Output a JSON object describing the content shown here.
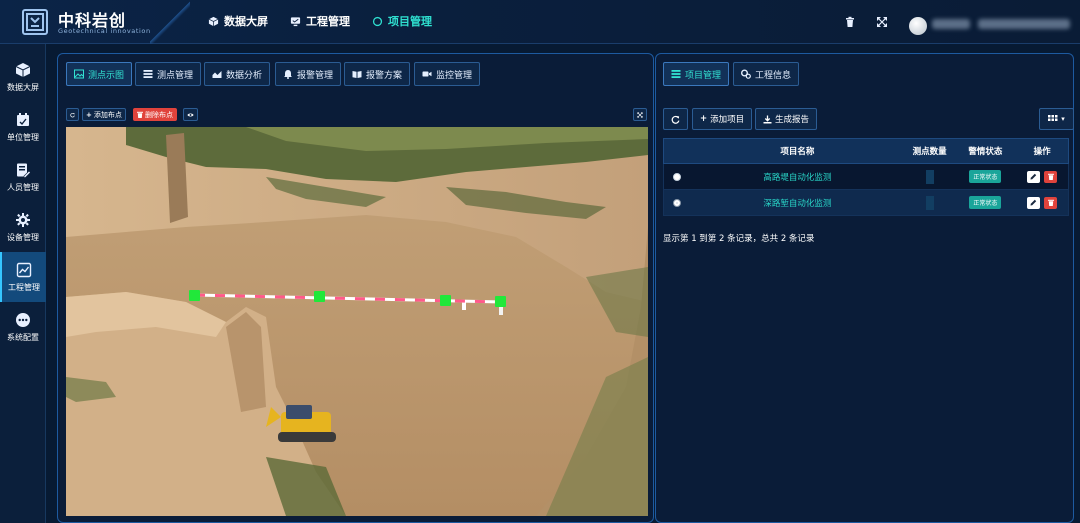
{
  "header": {
    "brand_name": "中科岩创",
    "brand_subtitle": "Geotechnical innovation",
    "nav": [
      {
        "label": "数据大屏",
        "icon": "cube-icon"
      },
      {
        "label": "工程管理",
        "icon": "monitor-icon"
      },
      {
        "label": "项目管理",
        "icon": "circle-icon",
        "active": true
      }
    ],
    "right_icons": [
      "trash-icon",
      "fullscreen-icon",
      "user-avatar"
    ]
  },
  "sidebar": {
    "items": [
      {
        "label": "数据大屏",
        "icon": "cube-icon"
      },
      {
        "label": "单位管理",
        "icon": "calendar-icon"
      },
      {
        "label": "人员管理",
        "icon": "user-edit-icon"
      },
      {
        "label": "设备管理",
        "icon": "gear-icon"
      },
      {
        "label": "工程管理",
        "icon": "chart-icon",
        "active": true
      },
      {
        "label": "系统配置",
        "icon": "more-icon"
      }
    ]
  },
  "left_panel": {
    "tabs": [
      {
        "label": "测点示图",
        "icon": "image-icon",
        "active": true
      },
      {
        "label": "测点管理",
        "icon": "list-icon"
      },
      {
        "label": "数据分析",
        "icon": "area-chart-icon"
      },
      {
        "label": "报警管理",
        "icon": "bell-icon"
      },
      {
        "label": "报警方案",
        "icon": "book-icon"
      },
      {
        "label": "监控管理",
        "icon": "video-icon"
      }
    ],
    "toolbar": {
      "add_point": "添加布点",
      "delete_point": "删除布点"
    }
  },
  "right_panel": {
    "tabs": [
      {
        "label": "项目管理",
        "icon": "list-icon",
        "active": true
      },
      {
        "label": "工程信息",
        "icon": "gears-icon"
      }
    ],
    "toolbar": {
      "add_project": "添加项目",
      "generate_report": "生成报告"
    },
    "table": {
      "columns": [
        "项目名称",
        "测点数量",
        "警情状态",
        "操作"
      ],
      "rows": [
        {
          "name": "高路堤自动化监测",
          "status": "正常状态",
          "selected": false
        },
        {
          "name": "深路堑自动化监测",
          "status": "正常状态",
          "selected": true
        }
      ],
      "footer": "显示第 1 到第 2 条记录，总共 2 条记录"
    }
  },
  "colors": {
    "accent": "#2fe0d0",
    "panel_border": "#1d5aa0",
    "danger": "#e0433c",
    "status_ok": "#1aa59a",
    "sensor_marker": "#21e83a"
  }
}
